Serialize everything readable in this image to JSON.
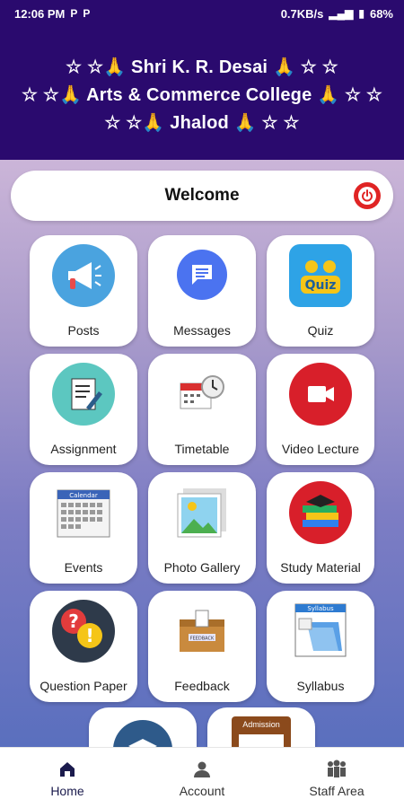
{
  "status_bar": {
    "time": "12:06 PM",
    "left_icons": [
      "P",
      "P"
    ],
    "network_speed": "0.7KB/s",
    "battery": "68%"
  },
  "header": {
    "line1": "☆🙏 Shri K. R. Desai 🙏 ☆",
    "line2": "☆🙏 Arts & Commerce College 🙏 ☆",
    "line3": "☆🙏 Jhalod 🙏 ☆",
    "background": "#2a0a6e"
  },
  "welcome": {
    "title": "Welcome"
  },
  "tiles": [
    {
      "label": "Posts",
      "icon": "megaphone-icon",
      "color": "#4aa3df"
    },
    {
      "label": "Messages",
      "icon": "chat-icon",
      "color": "#4b73f0"
    },
    {
      "label": "Quiz",
      "icon": "quiz-icon",
      "color": "#2ea3e6"
    },
    {
      "label": "Assignment",
      "icon": "assignment-icon",
      "color": "#5cc7c0"
    },
    {
      "label": "Timetable",
      "icon": "calendar-clock-icon",
      "color": "#d93030"
    },
    {
      "label": "Video Lecture",
      "icon": "video-camera-icon",
      "color": "#d81f2a"
    },
    {
      "label": "Events",
      "icon": "calendar-icon",
      "color": "#3a64b8"
    },
    {
      "label": "Photo Gallery",
      "icon": "photo-icon",
      "color": "#3aaadb"
    },
    {
      "label": "Study Material",
      "icon": "books-icon",
      "color": "#d81f2a"
    },
    {
      "label": "Question Paper",
      "icon": "question-alert-icon",
      "color": "#e23c3c"
    },
    {
      "label": "Feedback",
      "icon": "feedback-box-icon",
      "color": "#c98a3e"
    },
    {
      "label": "Syllabus",
      "icon": "syllabus-folder-icon",
      "color": "#2e7bd1"
    }
  ],
  "partial_tiles": [
    {
      "icon": "graduation-icon"
    },
    {
      "label": "Admission",
      "icon": "admission-icon"
    }
  ],
  "bottom_nav": [
    {
      "label": "Home",
      "icon": "home-icon",
      "active": true
    },
    {
      "label": "Account",
      "icon": "account-icon",
      "active": false
    },
    {
      "label": "Staff Area",
      "icon": "staff-icon",
      "active": false
    }
  ]
}
